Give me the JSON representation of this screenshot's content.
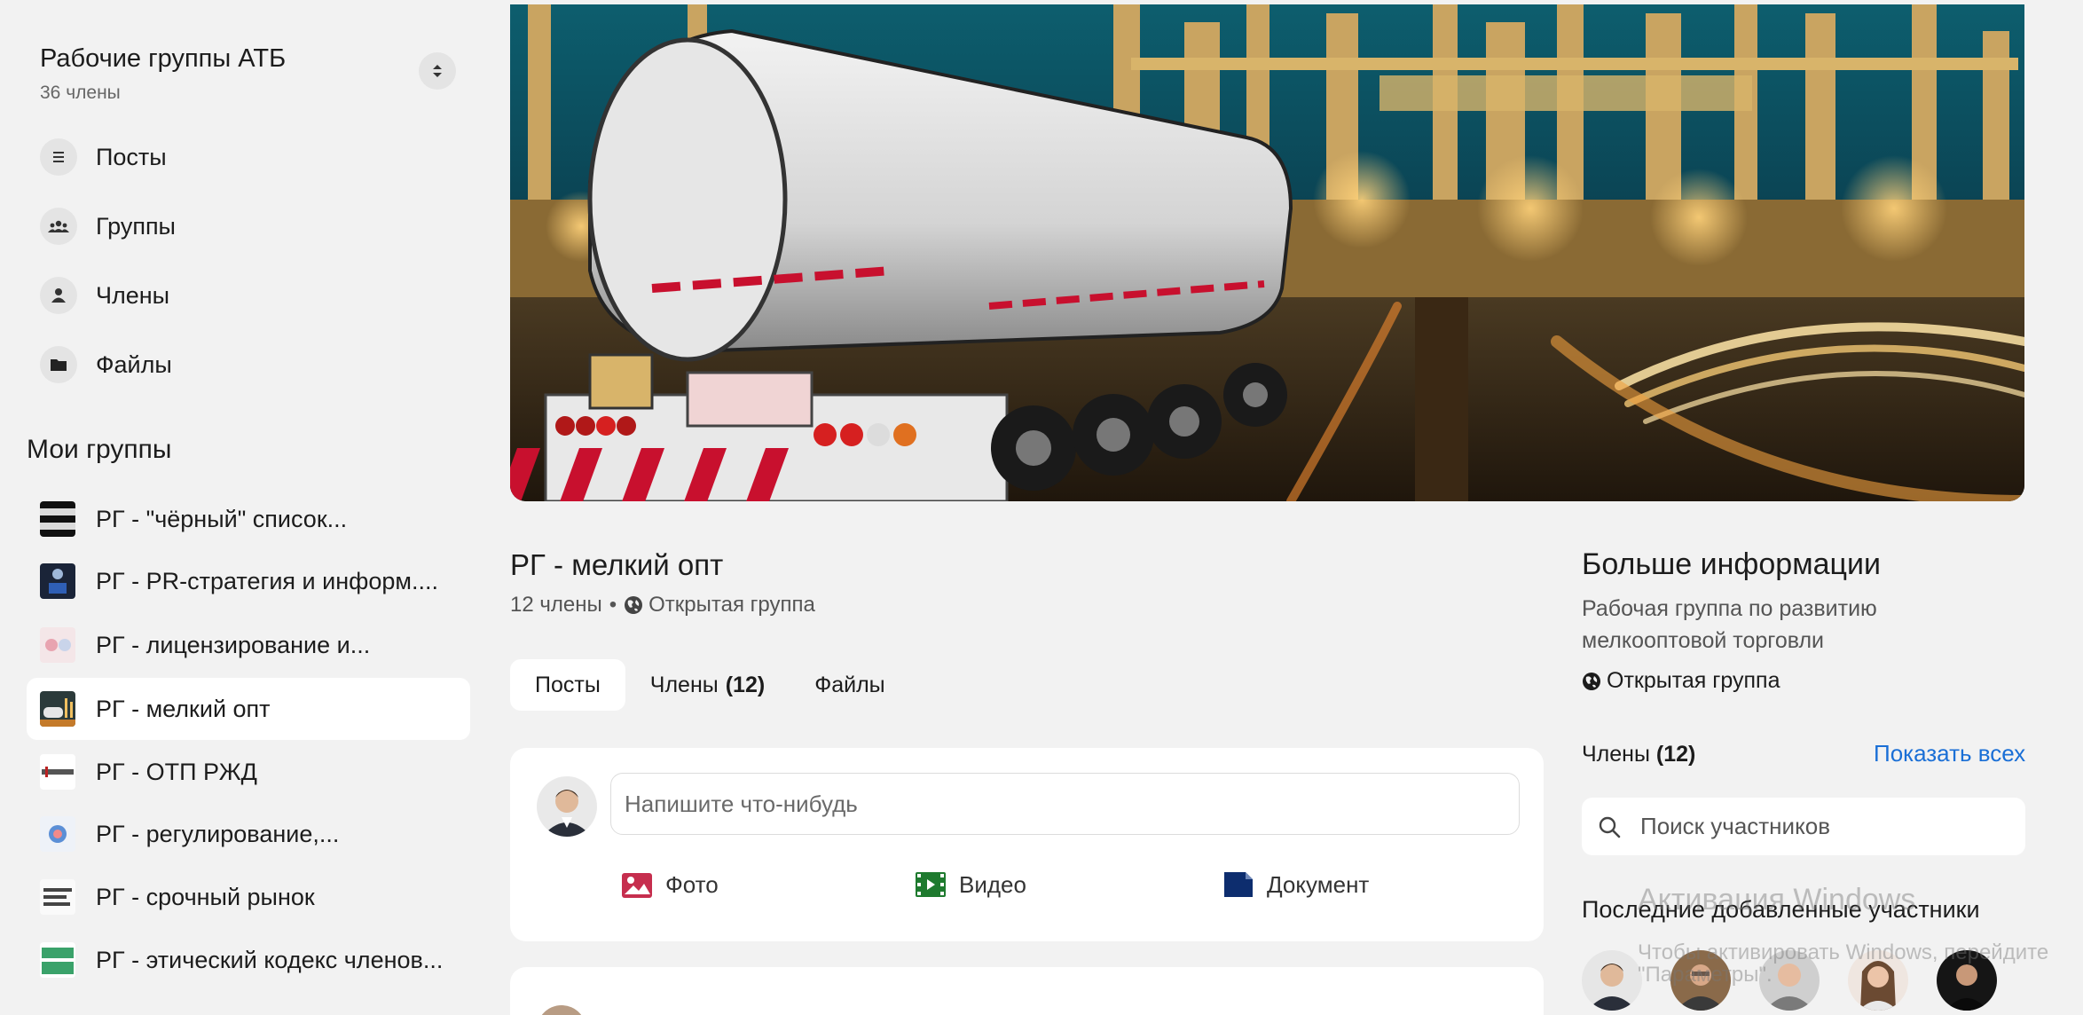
{
  "workspace": {
    "title": "Рабочие группы АТБ",
    "members": "36 члены"
  },
  "nav": [
    {
      "label": "Посты",
      "icon": "posts-icon"
    },
    {
      "label": "Группы",
      "icon": "groups-icon"
    },
    {
      "label": "Члены",
      "icon": "member-icon"
    },
    {
      "label": "Файлы",
      "icon": "folder-icon"
    }
  ],
  "my_groups": {
    "title": "Мои группы",
    "items": [
      {
        "label": "РГ - \"чёрный\" список...",
        "active": false
      },
      {
        "label": "РГ - PR-стратегия и информ....",
        "active": false
      },
      {
        "label": "РГ - лицензирование и...",
        "active": false
      },
      {
        "label": "РГ - мелкий опт",
        "active": true
      },
      {
        "label": "РГ - ОТП РЖД",
        "active": false
      },
      {
        "label": "РГ - регулирование,...",
        "active": false
      },
      {
        "label": "РГ - срочный рынок",
        "active": false
      },
      {
        "label": "РГ - этический кодекс членов...",
        "active": false
      }
    ]
  },
  "group": {
    "name": "РГ - мелкий опт",
    "members": "12 члены",
    "separator": "•",
    "type": "Открытая группа"
  },
  "tabs": [
    {
      "label": "Посты",
      "count": "",
      "active": true
    },
    {
      "label": "Члены",
      "count": "(12)",
      "active": false
    },
    {
      "label": "Файлы",
      "count": "",
      "active": false
    }
  ],
  "composer": {
    "placeholder": "Напишите что-нибудь",
    "photo": "Фото",
    "video": "Видео",
    "document": "Документ"
  },
  "info": {
    "title": "Больше информации",
    "description": "Рабочая группа по развитию мелкооптовой торговли",
    "type": "Открытая группа",
    "members_label": "Члены",
    "members_count": "(12)",
    "show_all": "Показать всех",
    "search_placeholder": "Поиск участников",
    "recent_title": "Последние добавленные участники"
  },
  "watermark": {
    "line1": "Активация Windows",
    "line2": "Чтобы активировать Windows, перейдите",
    "line3": "\"Параметры\"."
  },
  "colors": {
    "accent": "#1a6fd6",
    "photo": "#c62e4e",
    "video": "#1e7a2e",
    "document": "#0d2d6e"
  }
}
